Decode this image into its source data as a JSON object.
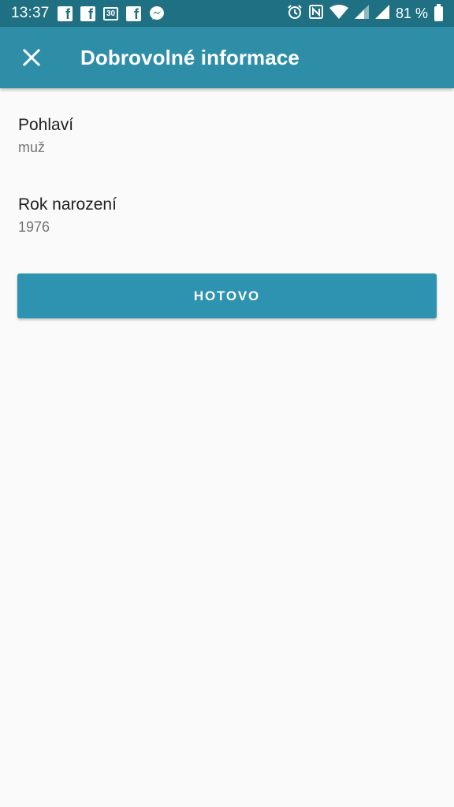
{
  "status_bar": {
    "time": "13:37",
    "battery_percent": "81 %",
    "notification_icons": [
      "facebook-icon",
      "facebook-icon",
      "calendar-icon",
      "facebook-icon",
      "messenger-icon"
    ],
    "calendar_day": "30",
    "system_icons": [
      "alarm-icon",
      "nfc-icon",
      "wifi-icon",
      "signal-icon",
      "signal-icon",
      "battery-icon"
    ]
  },
  "app_bar": {
    "title": "Dobrovolné informace",
    "close_icon": "close-icon",
    "background": "#2e8ea8"
  },
  "fields": [
    {
      "label": "Pohlaví",
      "value": "muž"
    },
    {
      "label": "Rok narození",
      "value": "1976"
    }
  ],
  "done_button": {
    "label": "HOTOVO",
    "color": "#2e93b0"
  }
}
